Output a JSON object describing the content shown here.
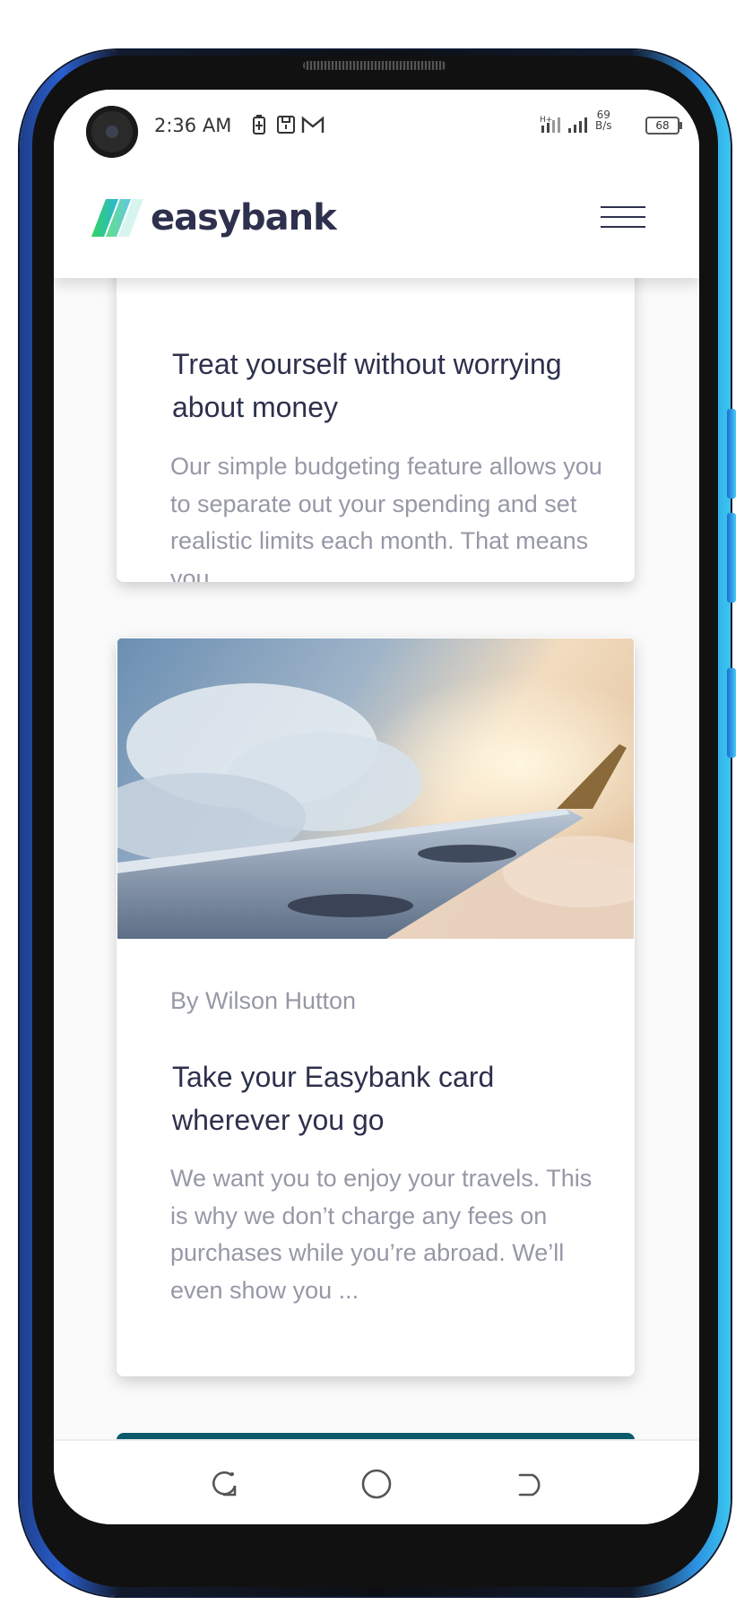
{
  "status_bar": {
    "time": "2:36 AM",
    "left_icons": [
      "battery-charging-icon",
      "sd-card-icon",
      "gmail-icon"
    ],
    "network": "H+",
    "speed_value": "69",
    "speed_unit": "B/s",
    "battery_level": "68"
  },
  "header": {
    "logo_text": "easybank",
    "logo_colors": [
      "#33d35e",
      "#2ab6d9"
    ],
    "menu_icon": "hamburger-icon"
  },
  "articles": [
    {
      "title": "Treat yourself without worrying about money",
      "excerpt": "Our simple budgeting feature allows you to separate out your spending and set realistic limits each month. That means you ..."
    },
    {
      "author": "By Wilson Hutton",
      "title": "Take your Easybank card wherever you go",
      "excerpt": "We want you to enjoy your travels. This is why we don’t charge any fees on purchases while you’re abroad. We’ll even show you ...",
      "image": "airplane-wing-above-clouds"
    }
  ],
  "nav": {
    "buttons": [
      "recents-icon",
      "home-icon",
      "back-icon"
    ]
  },
  "colors": {
    "title": "#2d314d",
    "body_text": "#9698a6",
    "background": "#fafafa"
  }
}
